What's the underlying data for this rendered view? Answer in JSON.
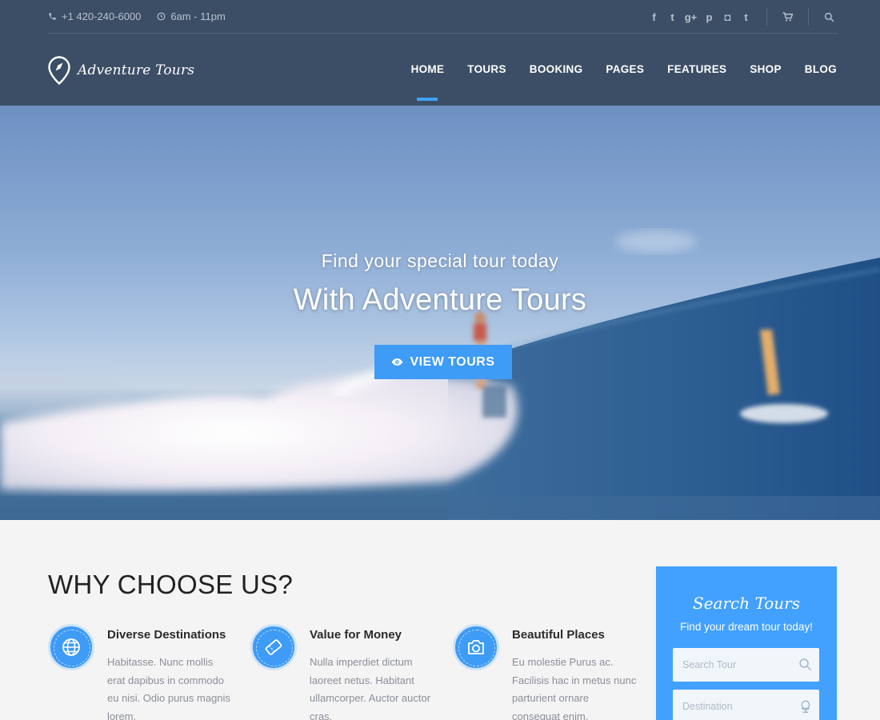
{
  "topbar": {
    "phone": "+1 420-240-6000",
    "hours": "6am - 11pm",
    "social": [
      {
        "icon": "facebook-icon",
        "glyph": "f"
      },
      {
        "icon": "twitter-icon",
        "glyph": "t"
      },
      {
        "icon": "google-plus-icon",
        "glyph": "g+"
      },
      {
        "icon": "pinterest-icon",
        "glyph": "p"
      },
      {
        "icon": "instagram-icon",
        "glyph": "◘"
      },
      {
        "icon": "tumblr-icon",
        "glyph": "t"
      }
    ]
  },
  "brand": {
    "name": "Adventure Tours"
  },
  "nav": {
    "items": [
      "HOME",
      "TOURS",
      "BOOKING",
      "PAGES",
      "FEATURES",
      "SHOP",
      "BLOG"
    ],
    "active": "HOME"
  },
  "hero": {
    "subtitle": "Find your special tour today",
    "title": "With Adventure Tours",
    "button": "VIEW TOURS"
  },
  "why": {
    "title": "WHY CHOOSE US?",
    "features": [
      {
        "icon": "globe-icon",
        "title": "Diverse Destinations",
        "text": "Habitasse. Nunc mollis erat dapibus in commodo eu nisi. Odio purus magnis lorem."
      },
      {
        "icon": "ticket-icon",
        "title": "Value for Money",
        "text": "Nulla imperdiet dictum laoreet netus. Habitant ullamcorper. Auctor auctor cras."
      },
      {
        "icon": "camera-icon",
        "title": "Beautiful Places",
        "text": "Eu molestie Purus ac. Facilisis hac in metus nunc parturient ornare consequat enim."
      }
    ]
  },
  "search": {
    "title": "Search Tours",
    "subtitle": "Find your dream tour today!",
    "search_placeholder": "Search Tour",
    "destination_placeholder": "Destination"
  },
  "colors": {
    "header_bg": "#3b4e66",
    "accent": "#42a1ff",
    "button": "#3e9bf6",
    "section_bg": "#f4f4f5"
  }
}
